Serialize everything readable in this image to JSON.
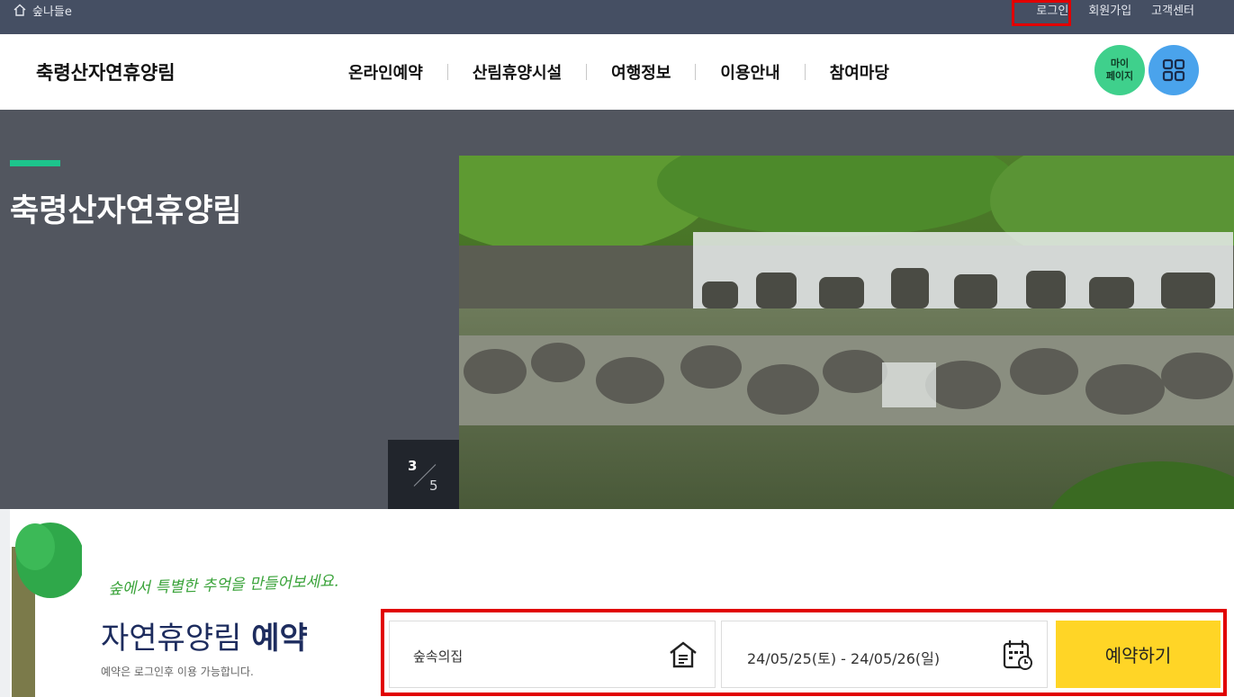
{
  "topbar": {
    "home_label": "숲나들e",
    "links": {
      "login": "로그인",
      "signup": "회원가입",
      "support": "고객센터"
    }
  },
  "header": {
    "logo": "축령산자연휴양림",
    "nav": [
      "온라인예약",
      "산림휴양시설",
      "여행정보",
      "이용안내",
      "참여마당"
    ],
    "mypage_line1": "마이",
    "mypage_line2": "페이지"
  },
  "hero": {
    "title": "축령산자연휴양림",
    "slide_current": "3",
    "slide_total": "5"
  },
  "reservation": {
    "slogan": "숲에서 특별한 추억을 만들어보세요.",
    "title_normal": "자연휴양림 ",
    "title_bold": "예약",
    "note": "예약은 로그인후 이용 가능합니다.",
    "facility_value": "숲속의집",
    "date_value": "24/05/25(토) - 24/05/26(일)",
    "submit_label": "예약하기"
  },
  "colors": {
    "topbar": "#454f63",
    "accent_green": "#1dc48c",
    "mypage_bg": "#3fd08c",
    "allmenu_bg": "#4aa3ec",
    "reserve_button": "#ffd526",
    "highlight_red": "#e10000"
  }
}
